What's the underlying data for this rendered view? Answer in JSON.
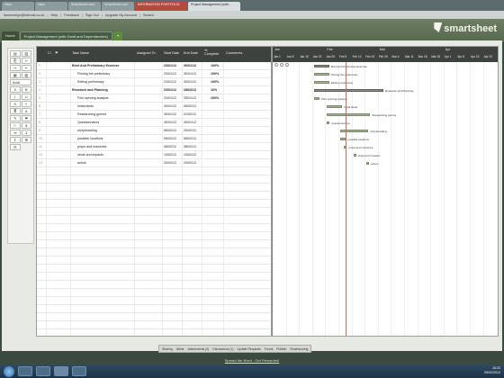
{
  "browser": {
    "tabs": [
      {
        "label": "https",
        "state": "normal"
      },
      {
        "label": "https",
        "state": "normal"
      },
      {
        "label": "Smartsheet.com",
        "state": "normal"
      },
      {
        "label": "Smartsheet.com",
        "state": "normal"
      },
      {
        "label": "INFORMATION PORTFOLIO",
        "state": "alert"
      },
      {
        "label": "Project Management (with...",
        "state": "active"
      }
    ]
  },
  "nav": {
    "user": "kennevelyn@hotmail.co.uk",
    "links": [
      "Help",
      "Feedback",
      "Sign Out",
      "Upgrade My Account",
      "Search"
    ]
  },
  "app": {
    "logo": "smartsheet",
    "sheet_tabs": [
      "Home",
      "Project Management (with Gantt and Dependencies)",
      "+"
    ]
  },
  "toolbar": {
    "buttons": [
      "▤",
      "▥",
      "⎘",
      "↩",
      "↪",
      "✂",
      "▦",
      "▧",
      "Arial",
      "9",
      "B",
      "I",
      "U",
      "S",
      "≡",
      "≣",
      "A",
      "✎",
      "⚑",
      "⚐",
      "$",
      "%",
      "↧",
      "↥",
      "⊞",
      "⊟"
    ]
  },
  "grid": {
    "headers": {
      "task": "Task Name",
      "assigned": "Assigned To",
      "start": "Start Date",
      "end": "End Date",
      "pct": "% Complete",
      "comments": "Comments"
    },
    "rows": [
      {
        "num": "1",
        "task": "Brief And Preliminary Exercise",
        "start": "23/01/12",
        "end": "30/01/12",
        "pct": "100%",
        "bold": true,
        "indent": false
      },
      {
        "num": "2",
        "task": "Filming the preliminary",
        "start": "23/01/12",
        "end": "30/01/12",
        "pct": "100%",
        "bold": false,
        "indent": true
      },
      {
        "num": "3",
        "task": "Editing preliminary",
        "start": "23/01/12",
        "end": "30/01/12",
        "pct": "100%",
        "bold": false,
        "indent": true
      },
      {
        "num": "4",
        "task": "Research and Planning",
        "start": "23/01/12",
        "end": "28/02/12",
        "pct": "10%",
        "bold": true,
        "indent": false
      },
      {
        "num": "5",
        "task": "Film opening analysis",
        "start": "23/01/12",
        "end": "25/01/12",
        "pct": "100%",
        "bold": false,
        "indent": true
      },
      {
        "num": "6",
        "task": "Initial ideas",
        "start": "30/01/12",
        "end": "06/02/12",
        "pct": "",
        "bold": false,
        "indent": true
      },
      {
        "num": "7",
        "task": "Researching genres",
        "start": "30/01/12",
        "end": "21/02/12",
        "pct": "",
        "bold": false,
        "indent": true
      },
      {
        "num": "8",
        "task": "Questionnaires",
        "start": "30/01/12",
        "end": "30/01/12",
        "pct": "",
        "bold": false,
        "indent": true
      },
      {
        "num": "9",
        "task": "storyboarding",
        "start": "06/02/12",
        "end": "20/02/12",
        "pct": "",
        "bold": false,
        "indent": true
      },
      {
        "num": "10",
        "task": "possible locations",
        "start": "06/02/12",
        "end": "08/02/12",
        "pct": "",
        "bold": false,
        "indent": true
      },
      {
        "num": "11",
        "task": "props and costumes",
        "start": "08/02/12",
        "end": "08/02/12",
        "pct": "",
        "bold": false,
        "indent": true
      },
      {
        "num": "12",
        "task": "shots and impacts",
        "start": "13/02/12",
        "end": "13/02/12",
        "pct": "",
        "bold": false,
        "indent": true
      },
      {
        "num": "13",
        "task": "actors",
        "start": "20/02/12",
        "end": "20/02/12",
        "pct": "",
        "bold": false,
        "indent": true
      }
    ]
  },
  "gantt": {
    "months": [
      "Jan",
      "Feb",
      "Mar",
      "Apr"
    ],
    "weeks": [
      "Jan 1",
      "Jan 8",
      "Jan 15",
      "Jan 22",
      "Jan 29",
      "Feb 5",
      "Feb 12",
      "Feb 19",
      "Feb 26",
      "Mar 4",
      "Mar 11",
      "Mar 18",
      "Mar 25",
      "Apr 1",
      "Apr 8",
      "Apr 15",
      "Apr 22"
    ],
    "bar_labels": [
      "Brief and Preliminary Exercise",
      "Filming the preliminary",
      "Editing preliminary",
      "Research and Planning",
      "Film opening analysis",
      "Initial ideas",
      "Researching genres",
      "Questionnaires",
      "storyboarding",
      "possible locations",
      "props and costumes",
      "shots and impacts",
      "actors"
    ]
  },
  "bottom_bar": {
    "items": [
      "Sharing",
      "Alerts",
      "Attachments (0)",
      "Discussions (1)",
      "Update Requests",
      "Forms",
      "Publish",
      "Smartscoring"
    ]
  },
  "promo": "Spread the Word - Get Rewarded!",
  "clock": {
    "time": "16:23",
    "date": "09/02/2012"
  }
}
